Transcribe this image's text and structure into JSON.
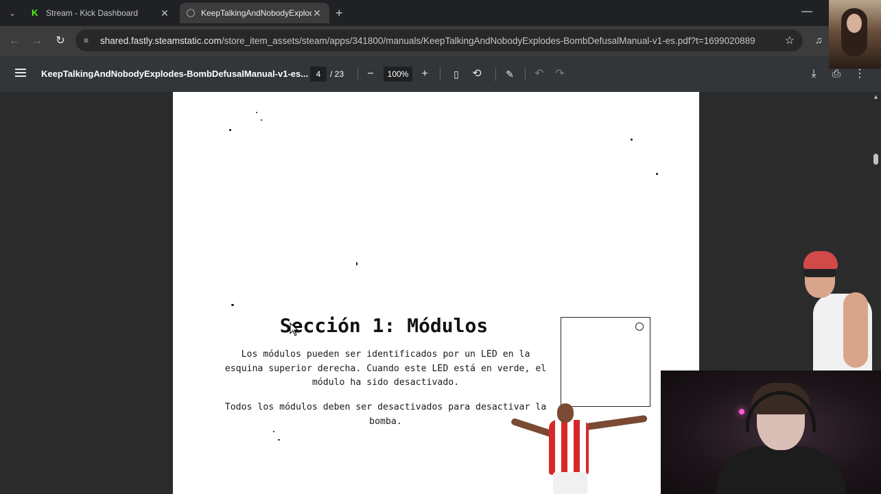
{
  "tabs": [
    {
      "title": "Stream - Kick Dashboard",
      "icon": "kick-icon",
      "active": false
    },
    {
      "title": "KeepTalkingAndNobodyExplodes",
      "icon": "globe-icon",
      "active": true
    }
  ],
  "address": {
    "host": "shared.fastly.steamstatic.com",
    "path": "/store_item_assets/steam/apps/341800/manuals/KeepTalkingAndNobodyExplodes-BombDefusalManual-v1-es.pdf?t=1699020889"
  },
  "pdf": {
    "title": "KeepTalkingAndNobodyExplodes-BombDefusalManual-v1-es...",
    "page_current": "4",
    "page_total": "/ 23",
    "zoom": "100%"
  },
  "document": {
    "section_title": "Sección 1: Módulos",
    "paragraph1": "Los módulos pueden ser identificados por un LED en la esquina superior derecha. Cuando este LED está en verde, el módulo ha sido desactivado.",
    "paragraph2": "Todos los módulos deben ser desactivados para desactivar la bomba."
  },
  "colors": {
    "tabstrip": "#202124",
    "toolbar": "#3c3c3c",
    "pdf_toolbar": "#323639",
    "viewer_bg": "#2b2b2b",
    "kick_green": "#53fc18"
  }
}
